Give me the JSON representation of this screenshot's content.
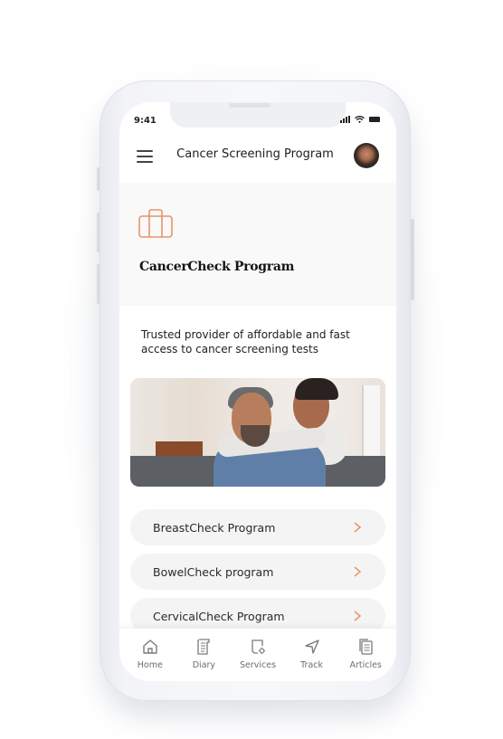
{
  "status_bar": {
    "time": "9:41"
  },
  "header": {
    "title": "Cancer Screening Program",
    "menu_icon": "hamburger-menu-icon",
    "avatar": "user-avatar"
  },
  "hero": {
    "icon": "briefcase-icon",
    "title": "CancerCheck Program"
  },
  "description": "Trusted provider of affordable and fast access to cancer screening tests",
  "image": {
    "alt": "Smiling couple embracing on a sofa"
  },
  "programs": [
    {
      "label": "BreastCheck Program",
      "icon": "chevron-right-icon"
    },
    {
      "label": "BowelCheck program",
      "icon": "chevron-right-icon"
    },
    {
      "label": "CervicalCheck Program",
      "icon": "chevron-right-icon"
    }
  ],
  "tabbar": [
    {
      "label": "Home",
      "icon": "home-icon"
    },
    {
      "label": "Diary",
      "icon": "diary-icon"
    },
    {
      "label": "Services",
      "icon": "services-icon"
    },
    {
      "label": "Track",
      "icon": "navigation-arrow-icon"
    },
    {
      "label": "Articles",
      "icon": "articles-icon"
    }
  ],
  "colors": {
    "accent": "#e8946a",
    "hero_bg": "#f9f9f9",
    "list_item_bg": "#f4f4f5",
    "text_primary": "#1d1d1d",
    "tab_text": "#6d6d6d"
  }
}
